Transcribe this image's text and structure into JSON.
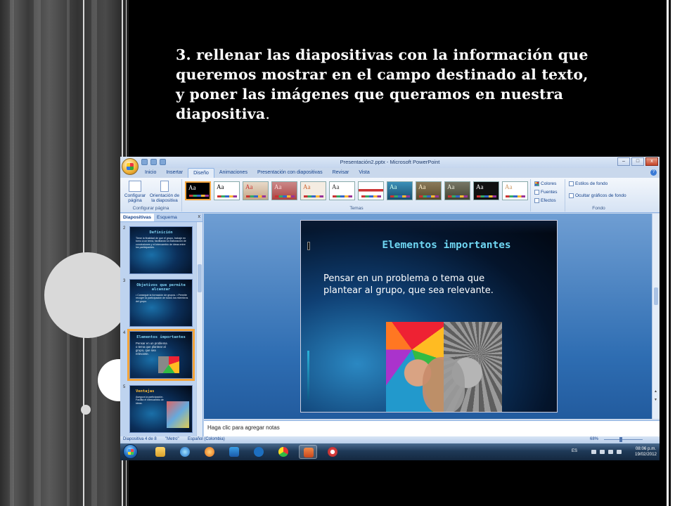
{
  "heading": {
    "line1": "3. rellenar las diapositivas con la información que",
    "line2": "queremos mostrar en el campo destinado al texto,",
    "line3": "y poner las imágenes que queramos en nuestra",
    "line4": "diapositiva",
    "line4_end": "."
  },
  "window": {
    "title": "Presentación2.pptx - Microsoft PowerPoint",
    "minimize": "–",
    "maximize": "□",
    "close": "x"
  },
  "ribbon_tabs": [
    "Inicio",
    "Insertar",
    "Diseño",
    "Animaciones",
    "Presentación con diapositivas",
    "Revisar",
    "Vista"
  ],
  "active_tab": "Diseño",
  "ribbon": {
    "page_setup_btn": "Configurar página",
    "orientation_btn": "Orientación de la diapositiva",
    "page_setup_group": "Configurar página",
    "themes_group": "Temas",
    "colors_btn": "Colores",
    "fonts_btn": "Fuentes",
    "effects_btn": "Efectos",
    "bg_styles_btn": "Estilos de fondo",
    "hide_bg_btn": "Ocultar gráficos de fondo",
    "background_group": "Fondo",
    "theme_sample": "Aa"
  },
  "sidebar": {
    "tabs": [
      "Diapositivas",
      "Esquema"
    ],
    "close": "x",
    "thumbnails": [
      {
        "num": "2",
        "title": "Definición",
        "text": "Tiene la finalidad de que el grupo, trabaje en torno a un tema, facilitando la elaboración de conclusiones y el intercambio de ideas entre los participantes."
      },
      {
        "num": "3",
        "title": "Objetivos que permite alcanzar",
        "text": "• Conseguir la formación de grupos. • Permite recoger la participación de todos los miembros del grupo."
      },
      {
        "num": "4",
        "title": "Elementos importantes",
        "text": "Pensar en un problema o tema que plantear al grupo, que sea relevante."
      },
      {
        "num": "5",
        "title": "Ventajas",
        "text": "Asegura la participación. Facilita el intercambio de ideas."
      }
    ]
  },
  "main_slide": {
    "title": "Elementos importantes",
    "body": "Pensar en un problema o tema que plantear al grupo, que sea relevante."
  },
  "notes": {
    "placeholder": "Haga clic para agregar notas"
  },
  "status": {
    "slide": "Diapositiva 4 de 8",
    "theme": "\"Metro\"",
    "language": "Español (Colombia)",
    "zoom": "68%"
  },
  "taskbar": {
    "lang": "ES",
    "time": "08:06 p.m.",
    "date": "19/02/2012"
  }
}
